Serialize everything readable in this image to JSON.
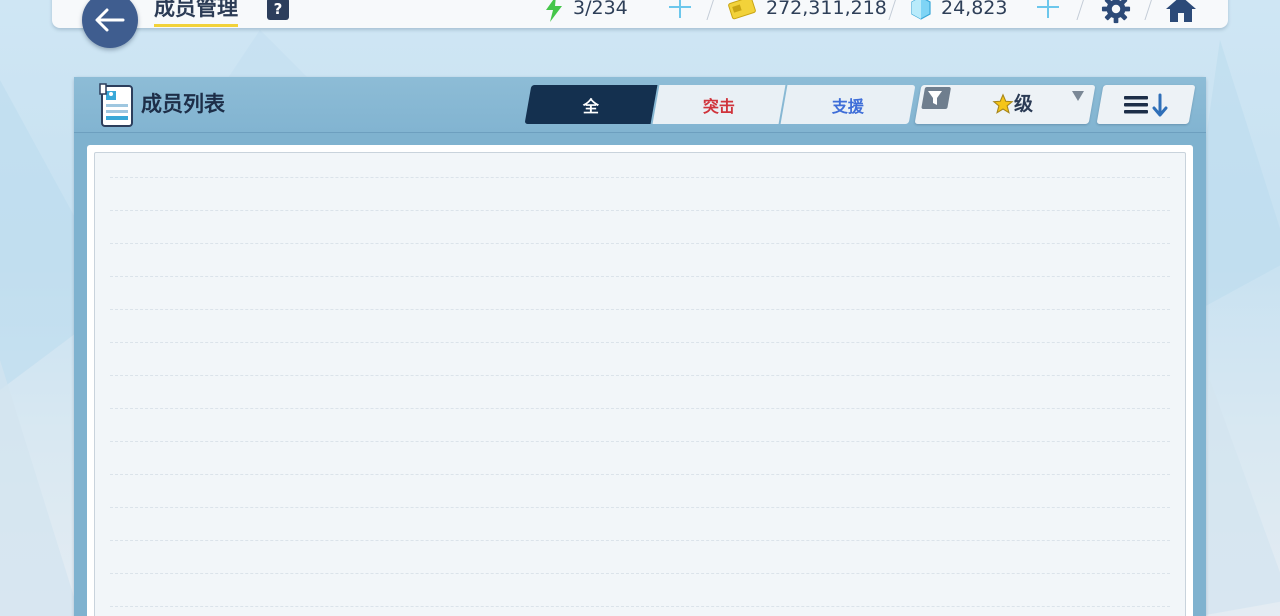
{
  "header": {
    "title": "成员管理",
    "help_label": "?",
    "stamina": "3/234",
    "credits": "272,311,218",
    "gems": "24,823"
  },
  "icons": {
    "back": "arrow-left-icon",
    "stamina": "lightning-icon",
    "credits": "credit-card-icon",
    "gems": "crystal-icon",
    "settings": "gear-icon",
    "home": "home-icon",
    "list": "member-card-icon",
    "filter": "funnel-icon",
    "sort": "sort-descending-icon",
    "star": "star-icon"
  },
  "panel": {
    "title": "成员列表",
    "tabs": [
      {
        "label": "全",
        "active": true
      },
      {
        "label": "突击",
        "active": false
      },
      {
        "label": "支援",
        "active": false
      }
    ],
    "filter_label": "级"
  },
  "colors": {
    "accent_dark": "#14304f",
    "strike_red": "#d0343c",
    "support_blue": "#3f6ed8",
    "title_underline": "#f2d23a",
    "plus_cyan": "#6cc7ec"
  }
}
